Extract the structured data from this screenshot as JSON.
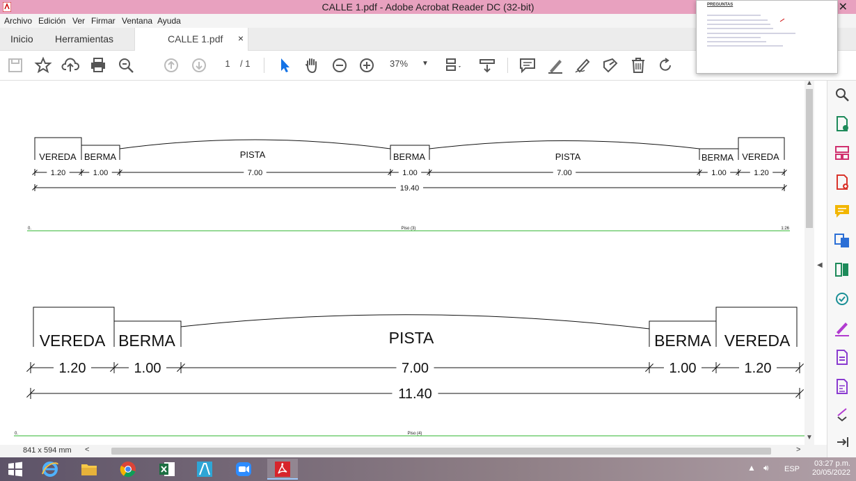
{
  "window": {
    "title": "CALLE 1.pdf - Adobe Acrobat Reader DC (32-bit)"
  },
  "menu": [
    "Archivo",
    "Edición",
    "Ver",
    "Firmar",
    "Ventana",
    "Ayuda"
  ],
  "tabs": {
    "home": "Inicio",
    "tools": "Herramientas",
    "document": "CALLE 1.pdf",
    "close": "×"
  },
  "toolbar": {
    "page_current": "1",
    "page_total": "/ 1",
    "zoom": "37%"
  },
  "popup": {
    "heading": "PREGUNTAS"
  },
  "drawing": {
    "top": {
      "labels": [
        "VEREDA",
        "BERMA",
        "PISTA",
        "BERMA",
        "PISTA",
        "BERMA",
        "VEREDA"
      ],
      "dims": [
        "1.20",
        "1.00",
        "7.00",
        "1.00",
        "7.00",
        "1.00",
        "1.20"
      ],
      "total": "19.40",
      "level_label": "Piso (3)",
      "level_left": "0.",
      "level_right": "1:26"
    },
    "bottom": {
      "labels": [
        "VEREDA",
        "BERMA",
        "PISTA",
        "BERMA",
        "VEREDA"
      ],
      "dims": [
        "1.20",
        "1.00",
        "7.00",
        "1.00",
        "1.20"
      ],
      "total": "11.40",
      "level_label": "Piso (4)",
      "level_left": "0."
    },
    "line_color": "#2db52d"
  },
  "status": {
    "page_size": "841 x 594 mm"
  },
  "taskbar": {
    "lang": "ESP",
    "time": "03:27 p.m.",
    "date": "20/05/2022"
  }
}
